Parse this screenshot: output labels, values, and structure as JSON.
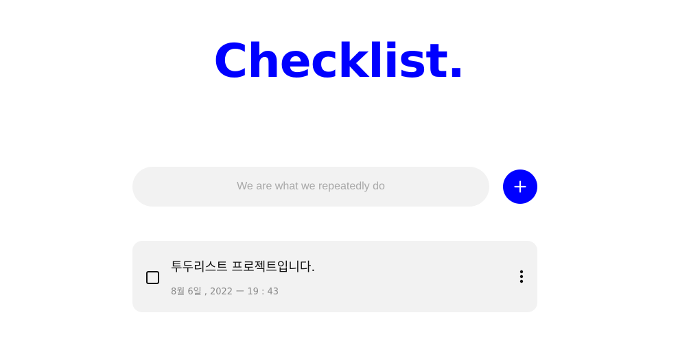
{
  "header": {
    "title": "Checklist."
  },
  "todo_input": {
    "placeholder": "We are what we repeatedly do",
    "value": ""
  },
  "add_button": {
    "icon": "plus-icon"
  },
  "todos": [
    {
      "text": "투두리스트 프로젝트입니다.",
      "date": "8월 6일 , 2022 ー 19 : 43",
      "checked": false
    }
  ],
  "colors": {
    "accent": "#0000ff",
    "input_background": "#f2f2f2",
    "card_background": "#f2f2f2",
    "placeholder": "#a8a8a8",
    "date_text": "#8a8a8a"
  },
  "icons": {
    "add": "plus-icon",
    "more": "more-vertical-icon",
    "checkbox": "checkbox-unchecked"
  }
}
